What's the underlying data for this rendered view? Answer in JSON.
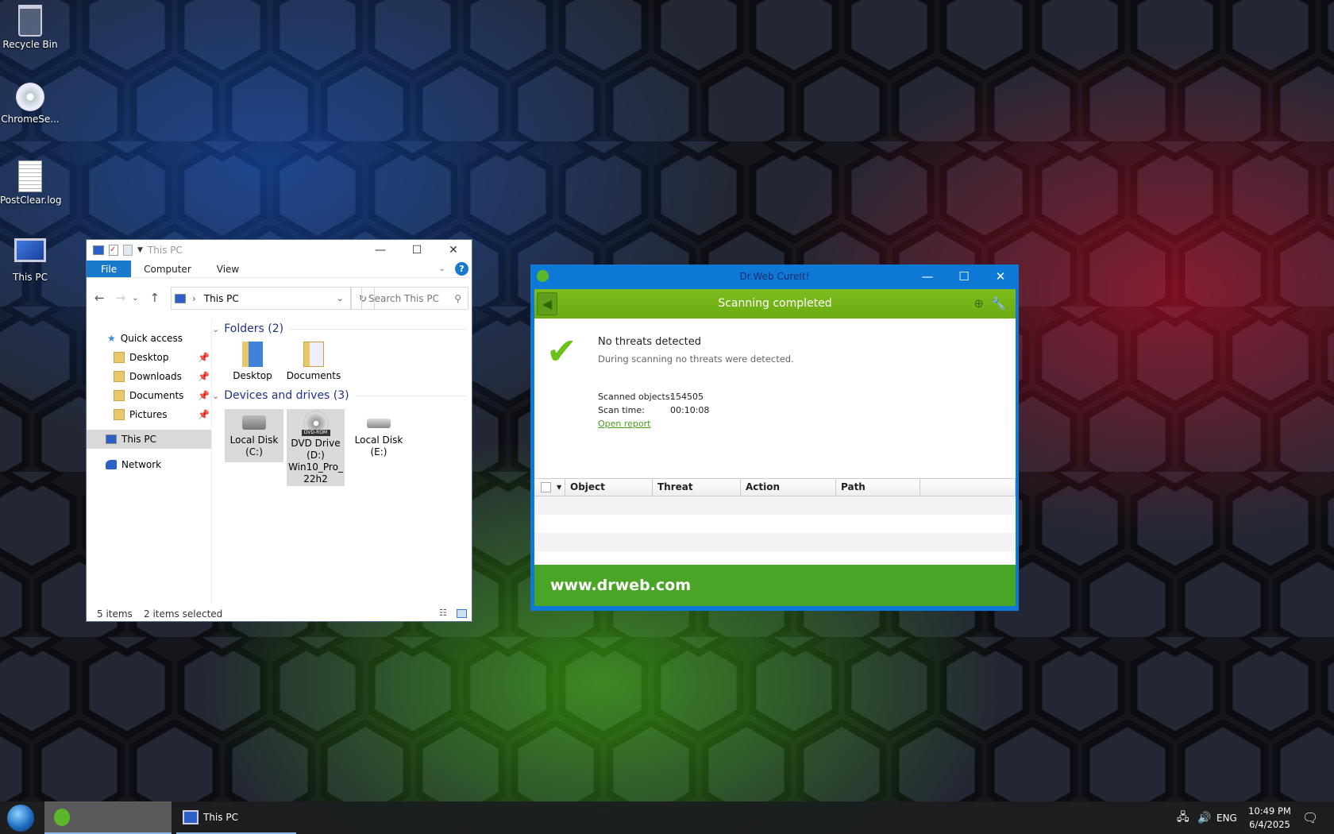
{
  "colors": {
    "drweb_blue": "#0e78d7",
    "drweb_green": "#4aa527",
    "explorer_accent": "#1979ca",
    "link": "#4a9a17"
  },
  "desktop": {
    "icons": [
      {
        "label": "Recycle Bin",
        "icon": "recycle-bin-icon"
      },
      {
        "label": "ChromeSe...",
        "icon": "setup-disc-icon"
      },
      {
        "label": "PostClear.log",
        "icon": "text-file-icon"
      },
      {
        "label": "This PC",
        "icon": "computer-icon"
      }
    ]
  },
  "explorer": {
    "title": "This PC",
    "tabs": [
      "File",
      "Computer",
      "View"
    ],
    "address": "This PC",
    "search_placeholder": "Search This PC",
    "nav": {
      "quick_access": "Quick access",
      "items": [
        "Desktop",
        "Downloads",
        "Documents",
        "Pictures"
      ],
      "this_pc": "This PC",
      "network": "Network"
    },
    "folders_header": "Folders (2)",
    "folders": [
      "Desktop",
      "Documents"
    ],
    "drives_header": "Devices and drives (3)",
    "drives": [
      {
        "name": "Local Disk",
        "letter": "(C:)"
      },
      {
        "name": "DVD Drive",
        "letter": "(D:)",
        "label": "Win10_Pro_",
        "label2": "22h2",
        "badge": "DVD-ROM"
      },
      {
        "name": "Local Disk",
        "letter": "(E:)"
      }
    ],
    "status": {
      "items": "5 items",
      "selected": "2 items selected"
    }
  },
  "drweb": {
    "title": "Dr.Web CureIt!",
    "status": "Scanning completed",
    "headline": "No threats detected",
    "subtitle": "During scanning no threats were detected.",
    "scanned_label": "Scanned objects:",
    "scanned_value": "154505",
    "time_label": "Scan time:",
    "time_value": "00:10:08",
    "open_report": "Open report",
    "columns": [
      "Object",
      "Threat",
      "Action",
      "Path"
    ],
    "footer": "www.drweb.com"
  },
  "taskbar": {
    "this_pc": "This PC",
    "lang": "ENG",
    "time": "10:49 PM",
    "date": "6/4/2025"
  }
}
